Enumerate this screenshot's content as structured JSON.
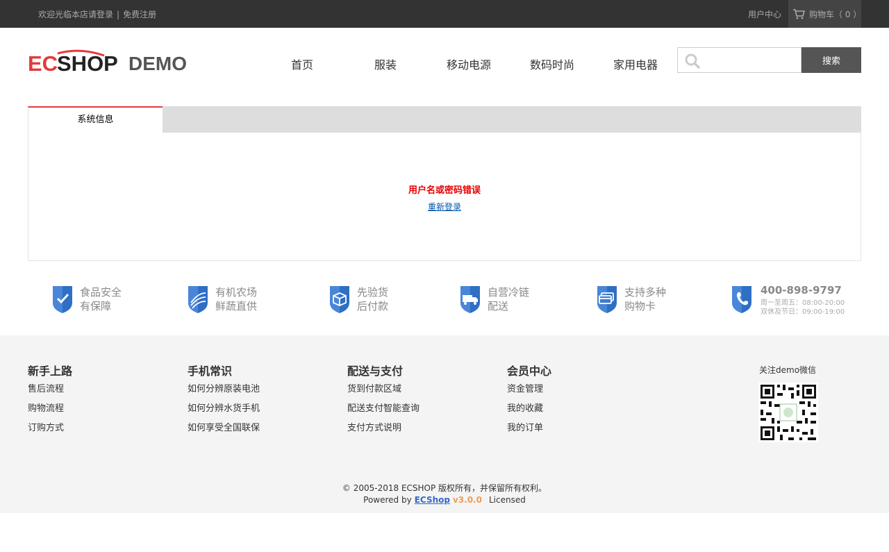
{
  "topbar": {
    "welcome_text": "欢迎光临本店请登录",
    "separator": "|",
    "register_link": "免费注册",
    "user_center": "用户中心",
    "cart_label": "购物车（ 0 ）",
    "cart_icon": "cart-icon"
  },
  "header": {
    "logo_text": "ECSHOP",
    "logo_sub": "DEMO",
    "nav": [
      {
        "label": "首页"
      },
      {
        "label": "服装"
      },
      {
        "label": "移动电源"
      },
      {
        "label": "数码时尚"
      },
      {
        "label": "家用电器"
      }
    ],
    "search": {
      "placeholder": "",
      "value": "",
      "button_label": "搜索",
      "icon": "search-icon"
    }
  },
  "panel": {
    "tab_label": "系统信息",
    "message": "用户名或密码错误",
    "relogin_link": "重新登录"
  },
  "promises": [
    {
      "line1": "食品安全",
      "line2": "有保障",
      "icon": "check-shield-icon"
    },
    {
      "line1": "有机农场",
      "line2": "鲜蔬直供",
      "icon": "farm-shield-icon"
    },
    {
      "line1": "先验货",
      "line2": "后付款",
      "icon": "box-shield-icon"
    },
    {
      "line1": "自营冷链",
      "line2": "配送",
      "icon": "truck-shield-icon"
    },
    {
      "line1": "支持多种",
      "line2": "购物卡",
      "icon": "card-shield-icon"
    }
  ],
  "hotline": {
    "number": "400-898-9797",
    "hours1": "周一至周五：08:00-20:00",
    "hours2": "双休及节日：09:00-19:00",
    "icon": "phone-shield-icon"
  },
  "footer": {
    "columns": [
      {
        "title": "新手上路",
        "links": [
          "售后流程",
          "购物流程",
          "订购方式"
        ]
      },
      {
        "title": "手机常识",
        "links": [
          "如何分辨原装电池",
          "如何分辨水货手机",
          "如何享受全国联保"
        ]
      },
      {
        "title": "配送与支付",
        "links": [
          "货到付款区域",
          "配送支付智能查询",
          "支付方式说明"
        ]
      },
      {
        "title": "会员中心",
        "links": [
          "资金管理",
          "我的收藏",
          "我的订单"
        ]
      }
    ],
    "wechat_label": "关注demo微信",
    "copyright": "© 2005-2018 ECSHOP 版权所有，并保留所有权利。",
    "powered_prefix": "Powered by",
    "powered_brand": "ECShop",
    "powered_version": "v3.0.0",
    "powered_suffix": "Licensed"
  },
  "colors": {
    "topbar_bg": "#333333",
    "accent_red": "#e4393c",
    "error_red": "#e60000",
    "shield_blue": "#2f6fc4",
    "footer_bg": "#f4f4f4"
  }
}
